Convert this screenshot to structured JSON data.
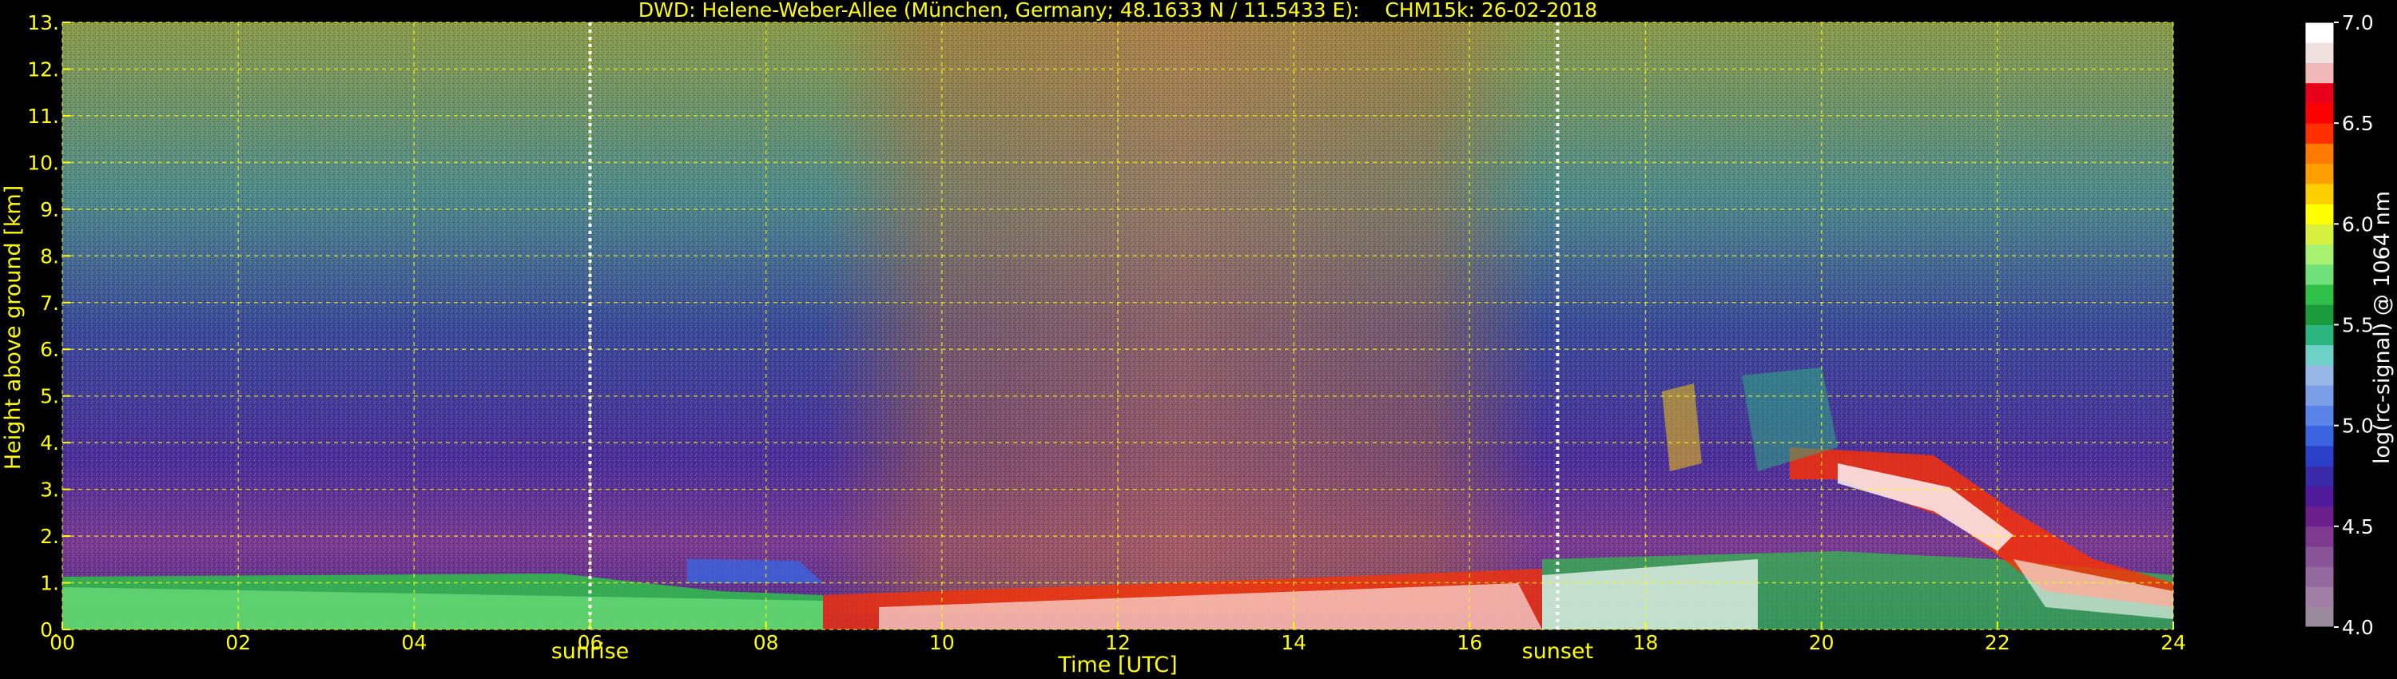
{
  "chart_data": {
    "type": "heatmap",
    "title": "DWD: Helene-Weber-Allee (München, Germany; 48.1633 N / 11.5433 E):    CHM15k: 26-02-2018",
    "xlabel": "Time [UTC]",
    "ylabel": "Height above ground [km]",
    "xlim": [
      0,
      24
    ],
    "ylim": [
      0,
      13
    ],
    "x_ticks": [
      "00",
      "02",
      "04",
      "06",
      "08",
      "10",
      "12",
      "14",
      "16",
      "18",
      "20",
      "22",
      "24"
    ],
    "x_tick_values": [
      0,
      2,
      4,
      6,
      8,
      10,
      12,
      14,
      16,
      18,
      20,
      22,
      24
    ],
    "y_ticks": [
      "0.",
      "1.",
      "2.",
      "3.",
      "4.",
      "5.",
      "6.",
      "7.",
      "8.",
      "9.",
      "10.",
      "11.",
      "12.",
      "13."
    ],
    "y_tick_values": [
      0,
      1,
      2,
      3,
      4,
      5,
      6,
      7,
      8,
      9,
      10,
      11,
      12,
      13
    ],
    "grid": true,
    "grid_color": "#ffff00",
    "text_color": "#ffff00",
    "background": "#000000",
    "markers": [
      {
        "label": "sunrise",
        "x": 6.0
      },
      {
        "label": "sunset",
        "x": 17.0
      }
    ],
    "colorbar": {
      "label": "log(rc-signal) @ 1064 nm",
      "range": [
        4.0,
        7.0
      ],
      "ticks": [
        "4.0",
        "4.5",
        "5.0",
        "5.5",
        "6.0",
        "6.5",
        "7.0"
      ],
      "tick_values": [
        4.0,
        4.5,
        5.0,
        5.5,
        6.0,
        6.5,
        7.0
      ],
      "colors": [
        "#9a8b9c",
        "#a07fa6",
        "#946a9e",
        "#8a5596",
        "#7d3a8f",
        "#6a1f8a",
        "#4e1a9a",
        "#3a2aaa",
        "#2a40c8",
        "#3a64e0",
        "#5a82e8",
        "#7a9ee8",
        "#98b6e6",
        "#6fd0c8",
        "#2ab580",
        "#1a9a3a",
        "#2fc04a",
        "#6fe07a",
        "#a8f070",
        "#d8f040",
        "#ffff00",
        "#ffd000",
        "#ffa000",
        "#ff7a00",
        "#ff3000",
        "#ff0000",
        "#e8001a",
        "#f0b8b8",
        "#f0e0e0",
        "#ffffff"
      ]
    }
  }
}
